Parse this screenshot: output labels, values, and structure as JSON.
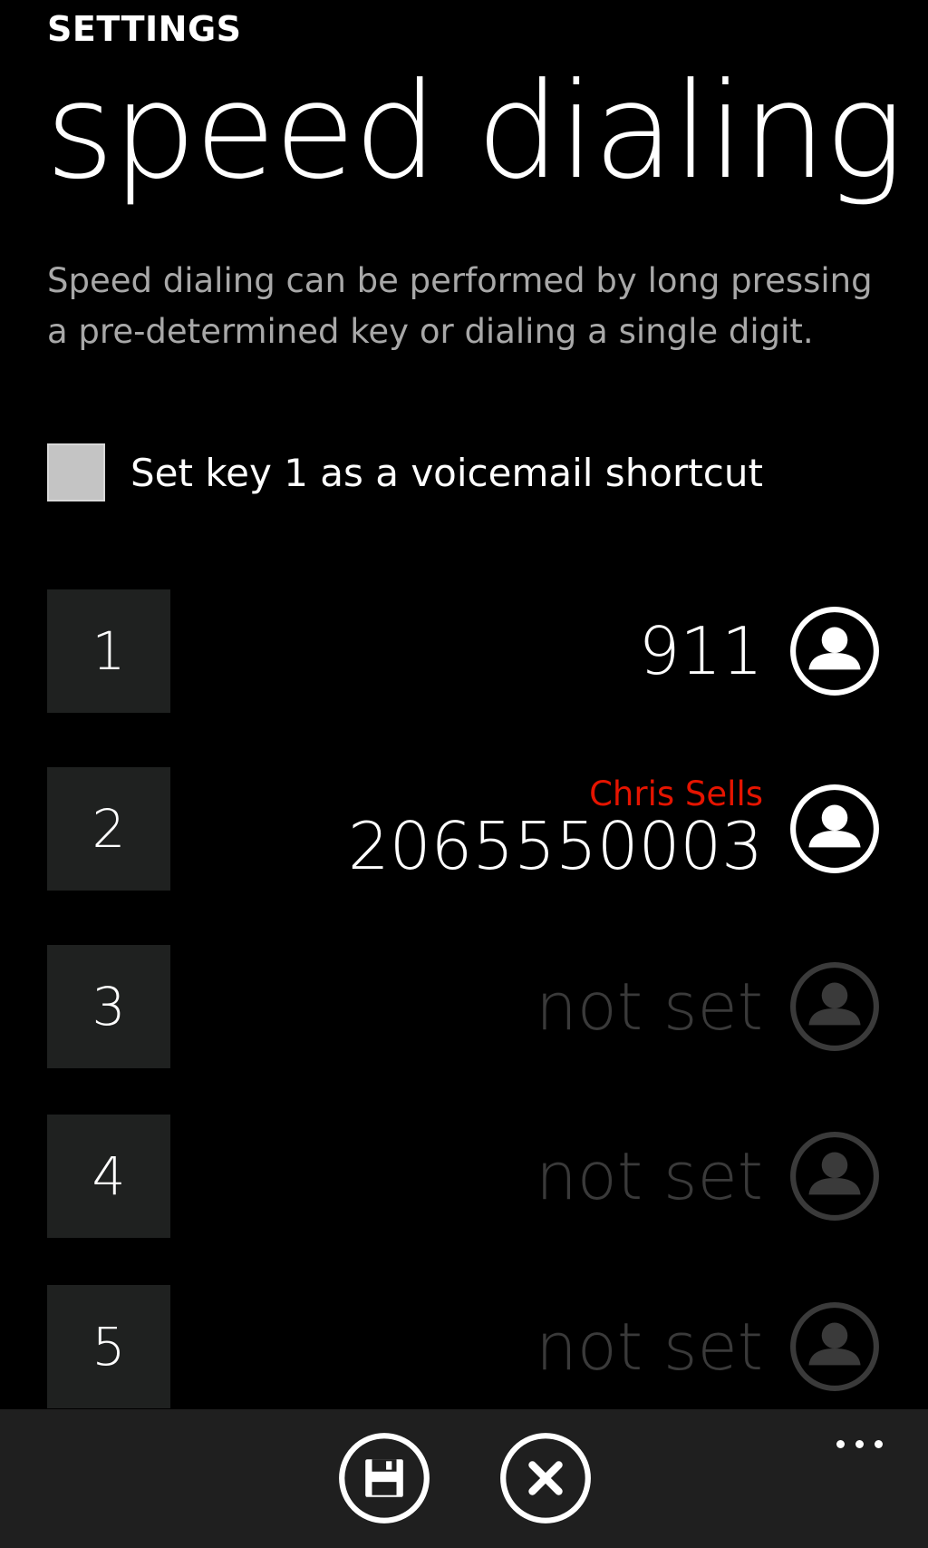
{
  "header": {
    "section_label": "SETTINGS",
    "title": "speed dialing"
  },
  "description": "Speed dialing can be performed by long pressing a pre-determined key or dialing a single digit.",
  "voicemail_option": {
    "label": "Set key 1 as a voicemail shortcut",
    "checked": false
  },
  "speed_dials": [
    {
      "key": "1",
      "name": "",
      "number": "911",
      "set": true
    },
    {
      "key": "2",
      "name": "Chris Sells",
      "number": "2065550003",
      "set": true
    },
    {
      "key": "3",
      "name": "",
      "number": "not set",
      "set": false
    },
    {
      "key": "4",
      "name": "",
      "number": "not set",
      "set": false
    },
    {
      "key": "5",
      "name": "",
      "number": "not set",
      "set": false
    }
  ],
  "app_bar": {
    "save_icon": "save-icon",
    "cancel_icon": "close-icon",
    "more_icon": "ellipsis-icon"
  },
  "colors": {
    "background": "#000000",
    "accent": "#e51400",
    "tile": "#1f2120",
    "disabled": "#3a3a3a",
    "app_bar": "#1f1f1f"
  }
}
